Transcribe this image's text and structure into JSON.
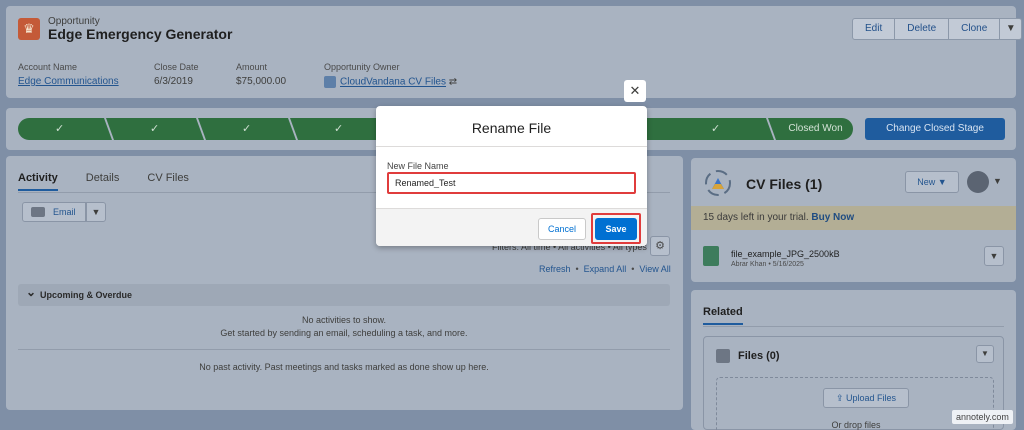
{
  "header": {
    "object_label": "Opportunity",
    "record_title": "Edge Emergency Generator",
    "actions": [
      "Edit",
      "Delete",
      "Clone"
    ],
    "fields": [
      {
        "label": "Account Name",
        "value": "Edge Communications"
      },
      {
        "label": "Close Date",
        "value": "6/3/2019"
      },
      {
        "label": "Amount",
        "value": "$75,000.00"
      },
      {
        "label": "Opportunity Owner",
        "value": "CloudVandana CV Files"
      }
    ]
  },
  "path": {
    "current_stage": "Closed Won",
    "change_button": "Change Closed Stage",
    "complete_icon": "checkmark-icon"
  },
  "activity": {
    "tabs": [
      "Activity",
      "Details",
      "CV Files"
    ],
    "email_button": "Email",
    "filters": "Filters: All time • All activities • All types",
    "links": [
      "Refresh",
      "Expand All",
      "View All"
    ],
    "upcoming_header": "Upcoming & Overdue",
    "no_activities": "No activities to show.",
    "get_started": "Get started by sending an email, scheduling a task, and more.",
    "no_past": "No past activity. Past meetings and tasks marked as done show up here."
  },
  "cv_files": {
    "title": "CV Files (1)",
    "new_button": "New",
    "trial_text": "15 days left in your trial.",
    "buy_now": "Buy Now",
    "file_name": "file_example_JPG_2500kB",
    "file_meta": "Abrar Khan • 5/16/2025"
  },
  "related": {
    "tab": "Related",
    "files_title": "Files (0)",
    "upload_button": "Upload Files",
    "drop_text": "Or drop files"
  },
  "modal": {
    "title": "Rename File",
    "field_label": "New File Name",
    "field_value": "Renamed_Test",
    "cancel": "Cancel",
    "save": "Save"
  },
  "watermark": "annotely.com",
  "colors": {
    "brand_blue": "#0070d2",
    "highlight_red": "#e03c3c",
    "path_green": "#2f6f3f"
  }
}
